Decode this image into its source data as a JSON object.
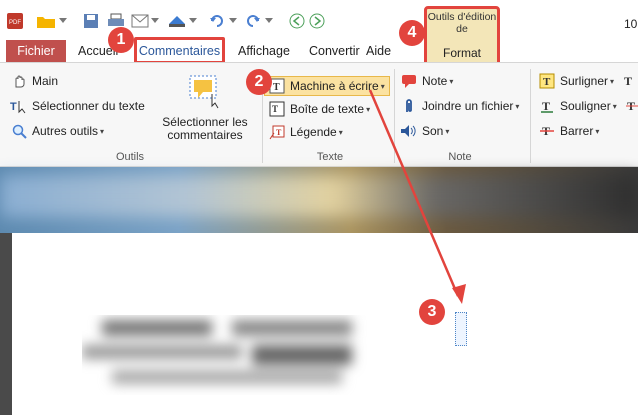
{
  "window": {
    "page_counter": "10",
    "quick_access": [
      "pdf-logo-icon",
      "open-folder-icon",
      "save-icon",
      "print-icon",
      "email-icon",
      "scan-icon",
      "undo-icon",
      "redo-icon",
      "back-icon",
      "forward-icon"
    ]
  },
  "contextual_group": {
    "title": "Outils d'édition de",
    "tab": "Format"
  },
  "tabs": {
    "fichier": "Fichier",
    "accueil": "Accueil",
    "commentaires": "Commentaires",
    "affichage": "Affichage",
    "convertir": "Convertir",
    "aide": "Aide"
  },
  "ribbon": {
    "outils": {
      "main": "Main",
      "select_text": "Sélectionner du texte",
      "other_tools": "Autres outils",
      "select_comments": "Sélectionner les commentaires",
      "group_label": "Outils"
    },
    "texte": {
      "typewriter": "Machine à écrire",
      "textbox": "Boîte de texte",
      "legend": "Légende",
      "group_label": "Texte"
    },
    "note": {
      "note": "Note",
      "attach_file": "Joindre un fichier",
      "sound": "Son",
      "group_label": "Note"
    },
    "markup": {
      "highlight": "Surligner",
      "underline": "Souligner",
      "strikeout": "Barrer"
    }
  },
  "callouts": [
    "1",
    "2",
    "3",
    "4"
  ],
  "colors": {
    "accent_red": "#e2443d",
    "fichier_tab": "#c0504d",
    "highlight_button": "#fbe2a1",
    "contextual_tab": "#f3e6b8",
    "link_blue": "#2b579a"
  }
}
